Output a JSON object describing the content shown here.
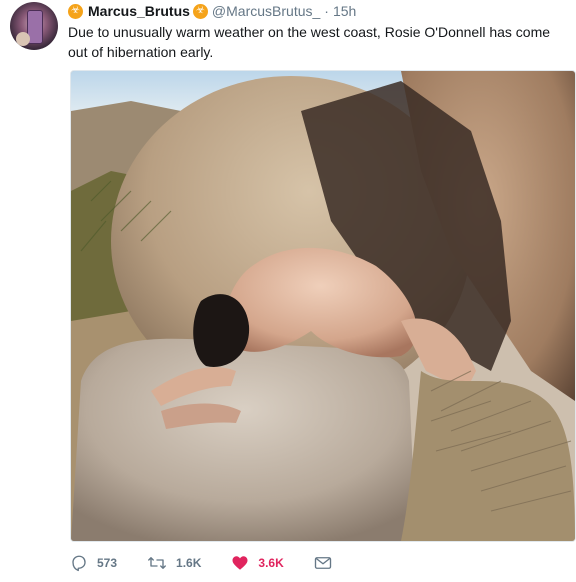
{
  "tweet": {
    "display_name": "Marcus_Brutus",
    "badge_glyph": "☣",
    "handle": "@MarcusBrutus_",
    "separator": "·",
    "time": "15h",
    "text": "Due to unusually warm weather on the west coast, Rosie O'Donnell has come out of hibernation early."
  },
  "actions": {
    "replies": "573",
    "retweets": "1.6K",
    "likes": "3.6K"
  },
  "colors": {
    "like_active": "#e0245e",
    "badge": "#f5a31a",
    "meta_gray": "#657786"
  }
}
